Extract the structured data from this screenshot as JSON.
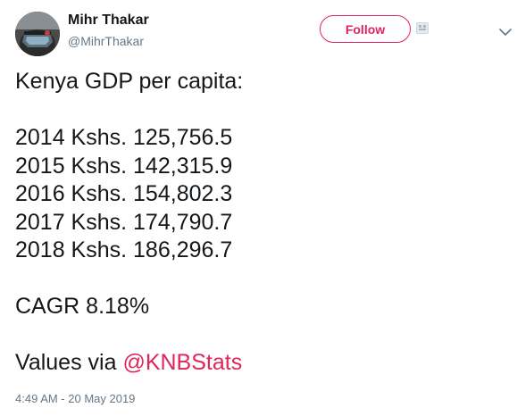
{
  "user": {
    "display_name": "Mihr Thakar",
    "handle": "@MihrThakar",
    "avatar_icon": "avatar-vr-headset-icon"
  },
  "header": {
    "follow_label": "Follow",
    "follow_color": "#e0245e",
    "more_icon": "chevron-down-icon"
  },
  "tweet": {
    "heading": "Kenya GDP per capita:",
    "rows": [
      "2014 Kshs. 125,756.5",
      "2015 Kshs. 142,315.9",
      "2016 Kshs. 154,802.3",
      "2017 Kshs. 174,790.7",
      "2018 Kshs. 186,296.7"
    ],
    "cagr": "CAGR 8.18%",
    "source_prefix": "Values via ",
    "source_mention": "@KNBStats",
    "timestamp": "4:49 AM - 20 May 2019"
  },
  "colors": {
    "accent": "#e0245e",
    "text": "#14171a",
    "muted": "#657786"
  }
}
